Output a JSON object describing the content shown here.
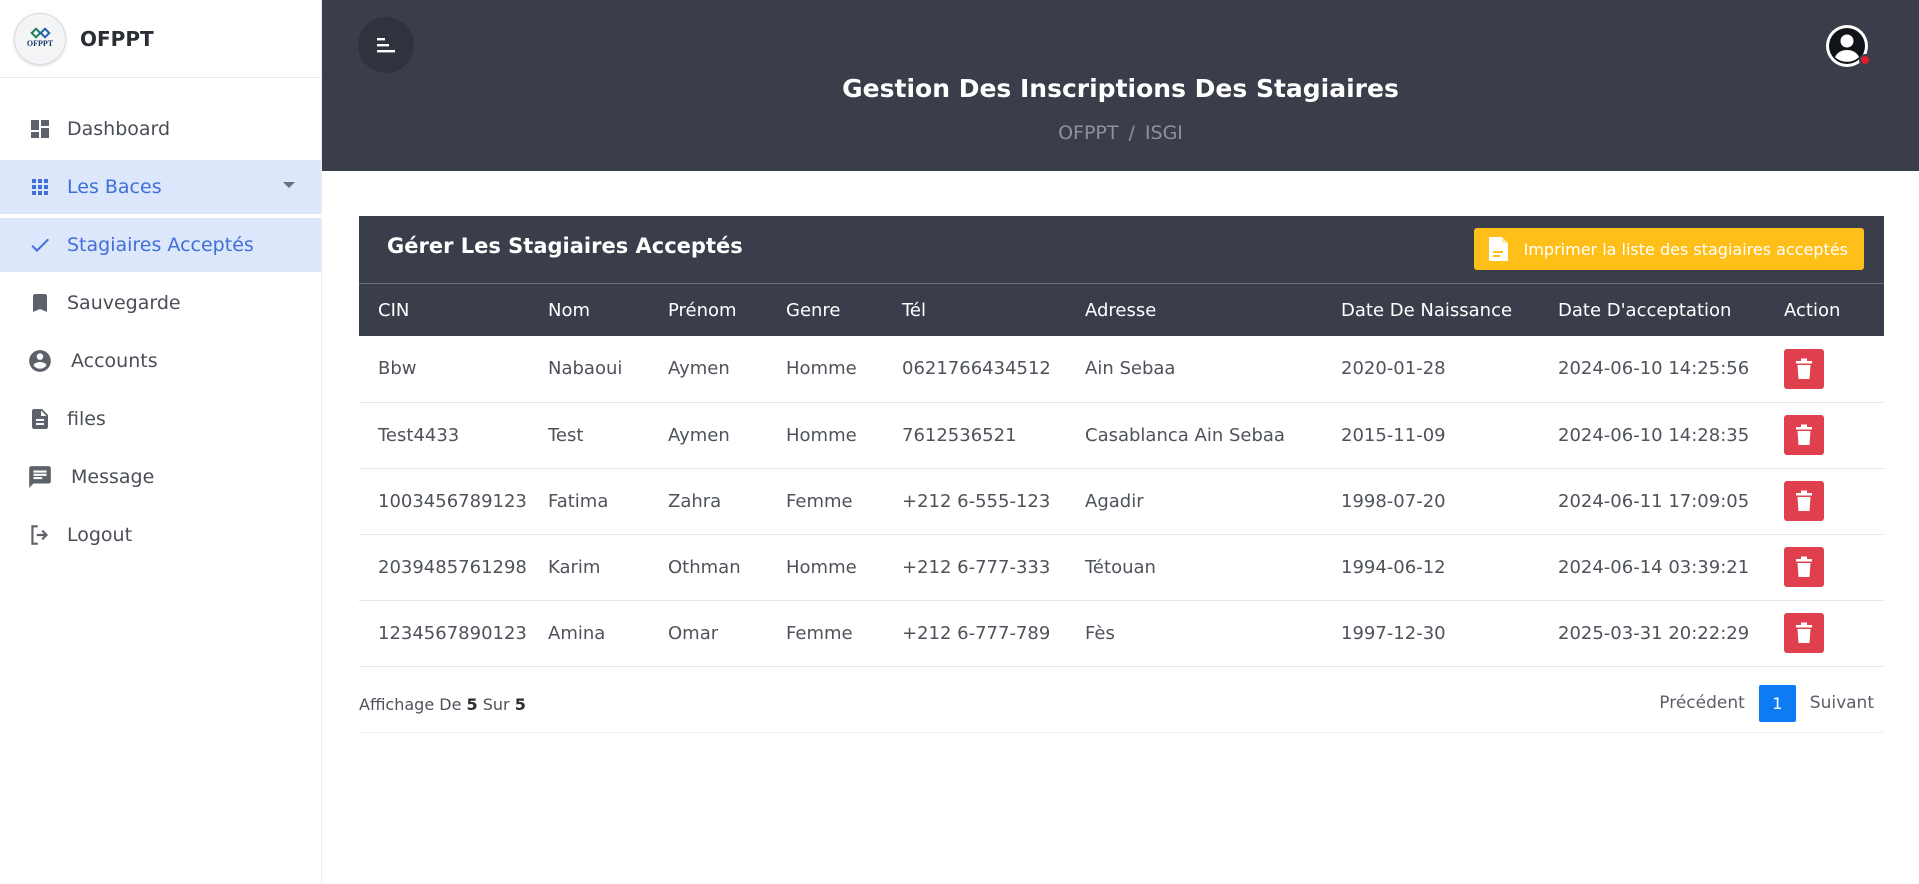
{
  "brand": {
    "logo_text": "OFPPT",
    "name": "OFPPT"
  },
  "sidebar": {
    "items": [
      {
        "label": "Dashboard",
        "icon": "dashboard-icon"
      },
      {
        "label": "Les Baces",
        "icon": "grid-icon",
        "active": true
      },
      {
        "label": "Stagiaires Acceptés",
        "icon": "check-icon",
        "active": true
      },
      {
        "label": "Sauvegarde",
        "icon": "bookmark-icon"
      },
      {
        "label": "Accounts",
        "icon": "account-icon"
      },
      {
        "label": "files",
        "icon": "file-icon"
      },
      {
        "label": "Message",
        "icon": "message-icon"
      },
      {
        "label": "Logout",
        "icon": "logout-icon"
      }
    ]
  },
  "header": {
    "title": "Gestion Des Inscriptions Des Stagiaires",
    "breadcrumb": [
      "OFPPT",
      "ISGI"
    ],
    "separator": "/"
  },
  "card": {
    "title": "Gérer Les Stagiaires Acceptés",
    "print_label": "Imprimer la liste des stagiaires acceptés"
  },
  "table": {
    "columns": [
      "CIN",
      "Nom",
      "Prénom",
      "Genre",
      "Tél",
      "Adresse",
      "Date De Naissance",
      "Date D'acceptation",
      "Action"
    ],
    "rows": [
      [
        "Bbw",
        "Nabaoui",
        "Aymen",
        "Homme",
        "0621766434512",
        "Ain Sebaa",
        "2020-01-28",
        "2024-06-10 14:25:56"
      ],
      [
        "Test4433",
        "Test",
        "Aymen",
        "Homme",
        "7612536521",
        "Casablanca Ain Sebaa",
        "2015-11-09",
        "2024-06-10 14:28:35"
      ],
      [
        "1003456789123",
        "Fatima",
        "Zahra",
        "Femme",
        "+212 6-555-123",
        "Agadir",
        "1998-07-20",
        "2024-06-11 17:09:05"
      ],
      [
        "2039485761298",
        "Karim",
        "Othman",
        "Homme",
        "+212 6-777-333",
        "Tétouan",
        "1994-06-12",
        "2024-06-14 03:39:21"
      ],
      [
        "1234567890123",
        "Amina",
        "Omar",
        "Femme",
        "+212 6-777-789",
        "Fès",
        "1997-12-30",
        "2025-03-31 20:22:29"
      ]
    ]
  },
  "pagination": {
    "info_prefix": "Affichage De",
    "shown": "5",
    "info_middle": "Sur",
    "total": "5",
    "prev_label": "Précédent",
    "current_page": "1",
    "next_label": "Suivant"
  },
  "colors": {
    "header_bg": "#393e4a",
    "accent_blue": "#3f6fd8",
    "active_bg": "#dde7fb",
    "print_button": "#fdbf18",
    "delete_button": "#e0404e",
    "page_active": "#0d7cf2"
  }
}
